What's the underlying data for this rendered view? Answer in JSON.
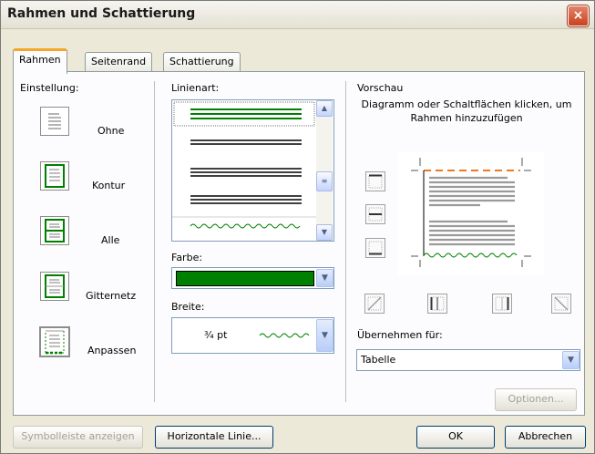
{
  "window": {
    "title": "Rahmen und Schattierung",
    "close_label": "×"
  },
  "tabs": [
    {
      "label": "Rahmen",
      "active": true
    },
    {
      "label": "Seitenrand",
      "active": false
    },
    {
      "label": "Schattierung",
      "active": false
    }
  ],
  "einstellung": {
    "label": "Einstellung:",
    "items": [
      {
        "label": "Ohne",
        "icon": "none-border-icon"
      },
      {
        "label": "Kontur",
        "icon": "box-border-icon"
      },
      {
        "label": "Alle",
        "icon": "all-border-icon"
      },
      {
        "label": "Gitternetz",
        "icon": "grid-border-icon"
      },
      {
        "label": "Anpassen",
        "icon": "custom-border-icon"
      }
    ]
  },
  "linienart": {
    "label": "Linienart:"
  },
  "farbe": {
    "label": "Farbe:",
    "color": "#008000"
  },
  "breite": {
    "label": "Breite:",
    "value": "¾ pt"
  },
  "vorschau": {
    "label": "Vorschau",
    "hint": "Diagramm oder Schaltflächen klicken, um Rahmen hinzuzufügen"
  },
  "uebernehmen": {
    "label": "Übernehmen für:",
    "value": "Tabelle"
  },
  "buttons": {
    "optionen": "Optionen...",
    "symbolleiste": "Symbolleiste anzeigen",
    "horizontale": "Horizontale Linie...",
    "ok": "OK",
    "abbrechen": "Abbrechen"
  },
  "colors": {
    "accent_green": "#008000",
    "tab_orange": "#f5a623",
    "dash_orange": "#f07820"
  }
}
